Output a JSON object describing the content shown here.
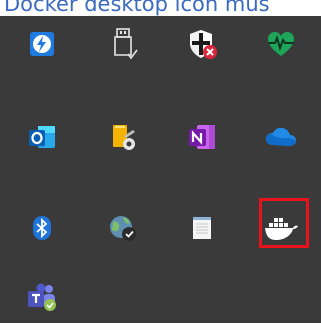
{
  "caption": {
    "text": "Docker desktop icon mus"
  },
  "tray": {
    "background": "#3a3a3a",
    "icons": [
      "power-automate-icon",
      "usb-safely-remove-icon",
      "windows-security-alert-icon",
      "health-monitor-icon",
      "outlook-icon",
      "fingerprint-key-icon",
      "onenote-icon",
      "onedrive-icon",
      "bluetooth-icon",
      "network-globe-icon",
      "notepad-icon",
      "docker-icon",
      "teams-icon"
    ],
    "highlight_color": "#e8131b"
  }
}
